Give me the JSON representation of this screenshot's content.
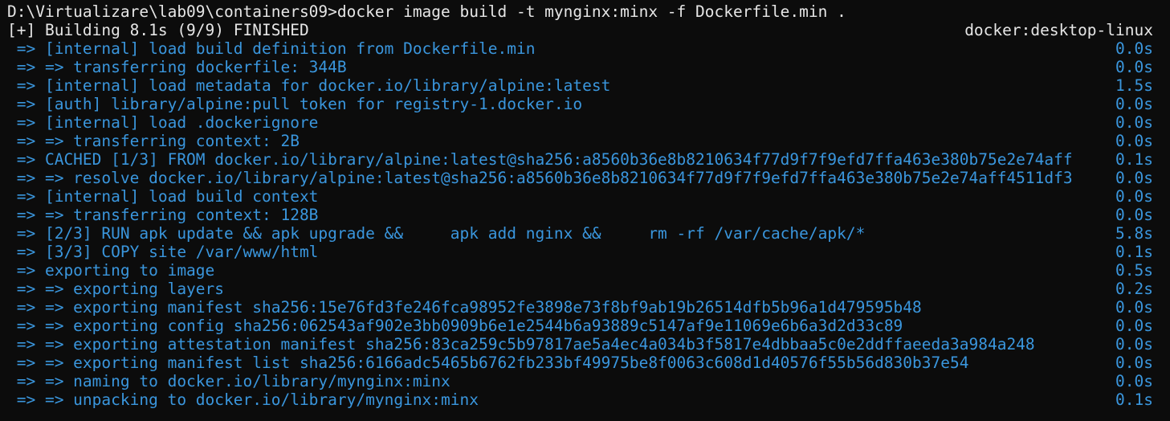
{
  "terminal": {
    "command_line": "D:\\Virtualizare\\lab09\\containers09>docker image build -t mynginx:minx -f Dockerfile.min .",
    "status": "[+] Building 8.1s (9/9) FINISHED",
    "context": "docker:desktop-linux",
    "steps": [
      {
        "text": " => [internal] load build definition from Dockerfile.min",
        "time": "0.0s"
      },
      {
        "text": " => => transferring dockerfile: 344B",
        "time": "0.0s"
      },
      {
        "text": " => [internal] load metadata for docker.io/library/alpine:latest",
        "time": "1.5s"
      },
      {
        "text": " => [auth] library/alpine:pull token for registry-1.docker.io",
        "time": "0.0s"
      },
      {
        "text": " => [internal] load .dockerignore",
        "time": "0.0s"
      },
      {
        "text": " => => transferring context: 2B",
        "time": "0.0s"
      },
      {
        "text": " => CACHED [1/3] FROM docker.io/library/alpine:latest@sha256:a8560b36e8b8210634f77d9f7f9efd7ffa463e380b75e2e74aff",
        "time": "0.1s"
      },
      {
        "text": " => => resolve docker.io/library/alpine:latest@sha256:a8560b36e8b8210634f77d9f7f9efd7ffa463e380b75e2e74aff4511df3",
        "time": "0.0s"
      },
      {
        "text": " => [internal] load build context",
        "time": "0.0s"
      },
      {
        "text": " => => transferring context: 128B",
        "time": "0.0s"
      },
      {
        "text": " => [2/3] RUN apk update && apk upgrade &&     apk add nginx &&     rm -rf /var/cache/apk/*",
        "time": "5.8s"
      },
      {
        "text": " => [3/3] COPY site /var/www/html",
        "time": "0.1s"
      },
      {
        "text": " => exporting to image",
        "time": "0.5s"
      },
      {
        "text": " => => exporting layers",
        "time": "0.2s"
      },
      {
        "text": " => => exporting manifest sha256:15e76fd3fe246fca98952fe3898e73f8bf9ab19b26514dfb5b96a1d479595b48",
        "time": "0.0s"
      },
      {
        "text": " => => exporting config sha256:062543af902e3bb0909b6e1e2544b6a93889c5147af9e11069e6b6a3d2d33c89",
        "time": "0.0s"
      },
      {
        "text": " => => exporting attestation manifest sha256:83ca259c5b97817ae5a4ec4a034b3f5817e4dbbaa5c0e2ddffaeeda3a984a248",
        "time": "0.0s"
      },
      {
        "text": " => => exporting manifest list sha256:6166adc5465b6762fb233bf49975be8f0063c608d1d40576f55b56d830b37e54",
        "time": "0.0s"
      },
      {
        "text": " => => naming to docker.io/library/mynginx:minx",
        "time": "0.0s"
      },
      {
        "text": " => => unpacking to docker.io/library/mynginx:minx",
        "time": "0.1s"
      }
    ]
  },
  "colors": {
    "background": "#0c0c0c",
    "foreground": "#e6e6e6",
    "step_blue": "#3a96dd"
  }
}
